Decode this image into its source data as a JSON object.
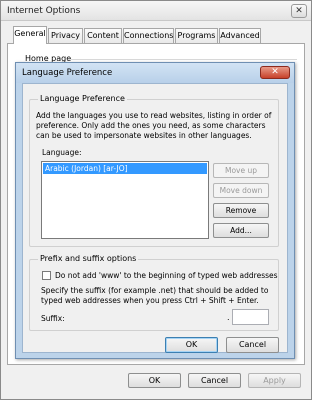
{
  "outer": {
    "title": "Internet Options",
    "close": "✕",
    "tabs": [
      "General",
      "Privacy",
      "Content",
      "Connections",
      "Programs",
      "Advanced"
    ],
    "active_tab": "General",
    "homepage_label": "Home page",
    "buttons": {
      "ok": "OK",
      "cancel": "Cancel",
      "apply": "Apply"
    }
  },
  "dialog": {
    "title": "Language Preference",
    "close": "✕",
    "group1": {
      "title": "Language Preference",
      "description": "Add the languages you use to read websites, listing in order of preference. Only add the ones you need, as some characters can be used to impersonate websites in other languages.",
      "language_label": "Language:",
      "languages": [
        "Arabic (Jordan) [ar-JO]"
      ],
      "buttons": {
        "move_up": "Move up",
        "move_down": "Move down",
        "remove": "Remove",
        "add": "Add..."
      }
    },
    "group2": {
      "title": "Prefix and suffix options",
      "checkbox_label": "Do not add 'www' to the beginning of typed web addresses",
      "checkbox_checked": false,
      "description": "Specify the suffix (for example .net) that should be added to typed web addresses when you press Ctrl + Shift + Enter.",
      "suffix_label": "Suffix:",
      "suffix_dot": ".",
      "suffix_value": ""
    },
    "buttons": {
      "ok": "OK",
      "cancel": "Cancel"
    }
  }
}
